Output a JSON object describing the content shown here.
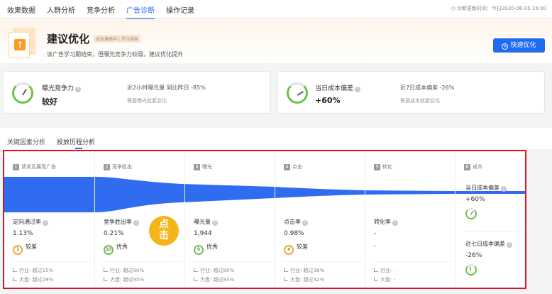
{
  "topnav": {
    "tabs": [
      "效果数据",
      "人群分析",
      "竞争分析",
      "广告诊断",
      "操作记录"
    ],
    "active_tab": "广告诊断",
    "diag_time": "诊断更新时间：今日2020-06-05 15:00"
  },
  "hero": {
    "title": "建议优化",
    "badge": "成本偏高中 | 学习结束",
    "desc": "该广告学习期结束，但曝光竞争力较弱，建议优化提升",
    "button": "快速优化"
  },
  "cards": [
    {
      "label": "曝光竞争力",
      "value": "较好",
      "sub": "近2小时曝光量 同比昨日 -85%",
      "note": "需要曝光就要变化"
    },
    {
      "label": "当日成本偏差",
      "value": "+60%",
      "sub": "近7日成本偏差 -26%",
      "note": "需要成本就要变化"
    }
  ],
  "subtabs": [
    "关键因素分析",
    "投放历程分析"
  ],
  "funnel": {
    "stages": [
      {
        "num": "1",
        "title": "请求及展现广告",
        "metric": "定向通过率",
        "value": "1.13%",
        "score": "3",
        "level": "较差",
        "industry": "行业: 超过15%",
        "market": "大盘: 超过29%"
      },
      {
        "num": "2",
        "title": "竞争胜出",
        "metric": "竞争胜出率",
        "value": "0.21%",
        "score": "10",
        "level": "优秀",
        "industry": "行业: 超过90%",
        "market": "大盘: 超过95%"
      },
      {
        "num": "3",
        "title": "曝光",
        "metric": "曝光量",
        "value": "1,944",
        "score": "9",
        "level": "优秀",
        "industry": "行业: 超过80%",
        "market": "大盘: 超过83%"
      },
      {
        "num": "4",
        "title": "点击",
        "metric": "点击率",
        "value": "0.98%",
        "score": "4",
        "level": "较差",
        "industry": "行业: 超过38%",
        "market": "大盘: 超过32%"
      },
      {
        "num": "5",
        "title": "转化",
        "metric": "转化率",
        "value": "-",
        "score": "",
        "level": "",
        "rate_text": "-",
        "industry": "行业: -",
        "market": "大盘: -"
      },
      {
        "num": "6",
        "title": "成本"
      }
    ],
    "cost": {
      "today_label": "当日成本偏差",
      "today_value": "+60%",
      "week_label": "近七日成本偏差",
      "week_value": "-26%"
    },
    "click_badge": [
      "点",
      "击"
    ]
  },
  "colors": {
    "accent": "#1f6bf0",
    "highlight": "#e0141c",
    "good": "#6cc24a",
    "warn": "#f0a830",
    "badge": "#f5b418"
  }
}
